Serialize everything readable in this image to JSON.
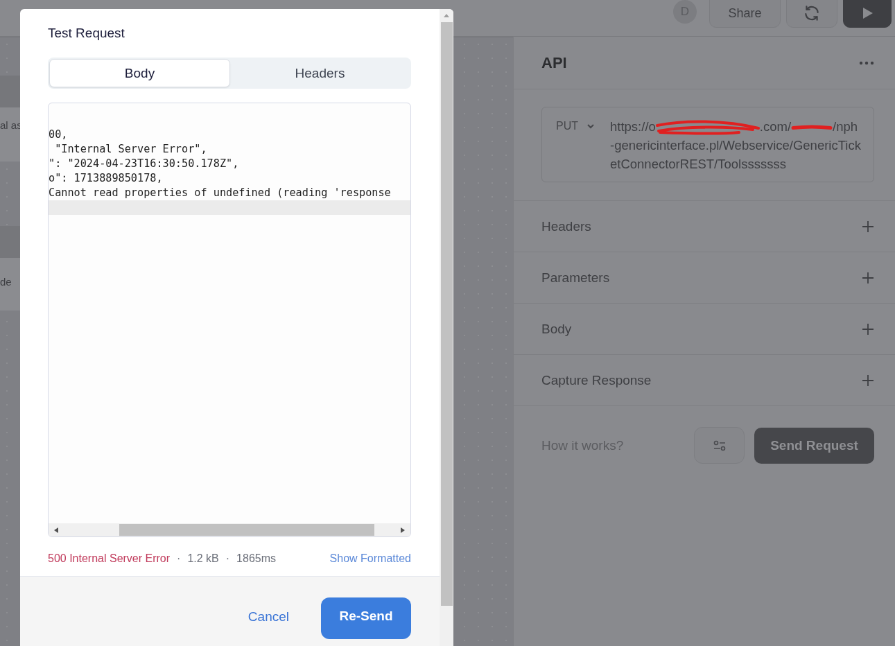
{
  "top_bar": {
    "avatar": "D",
    "share": "Share"
  },
  "canvas_fragments": [
    "al as",
    "de"
  ],
  "panel": {
    "title": "API",
    "method": "PUT",
    "url_parts": [
      {
        "kind": "text",
        "text": "https://o"
      },
      {
        "kind": "redacted"
      },
      {
        "kind": "text",
        "text": ".com/"
      },
      {
        "kind": "redacted"
      },
      {
        "kind": "text",
        "text": "/nph-genericinterface.pl/Webservice/GenericTicketConnectorREST/Toolsssssss"
      }
    ],
    "sections": [
      {
        "label": "Headers"
      },
      {
        "label": "Parameters"
      },
      {
        "label": "Body"
      },
      {
        "label": "Capture Response"
      }
    ],
    "how_it_works": "How it works?",
    "send": "Send Request"
  },
  "dialog": {
    "title": "Test Request",
    "tabs": [
      {
        "label": "Body",
        "selected": true
      },
      {
        "label": "Headers",
        "selected": false
      }
    ],
    "code_lines": [
      "00,",
      " \"Internal Server Error\",",
      "\": \"2024-04-23T16:30:50.178Z\",",
      "o\": 1713889850178,",
      "Cannot read properties of undefined (reading 'response"
    ],
    "status": "500 Internal Server Error",
    "meta": [
      "·",
      "1.2 kB",
      "·",
      "1865ms"
    ],
    "show_formatted": "Show Formatted",
    "cancel": "Cancel",
    "resend": "Re-Send"
  }
}
